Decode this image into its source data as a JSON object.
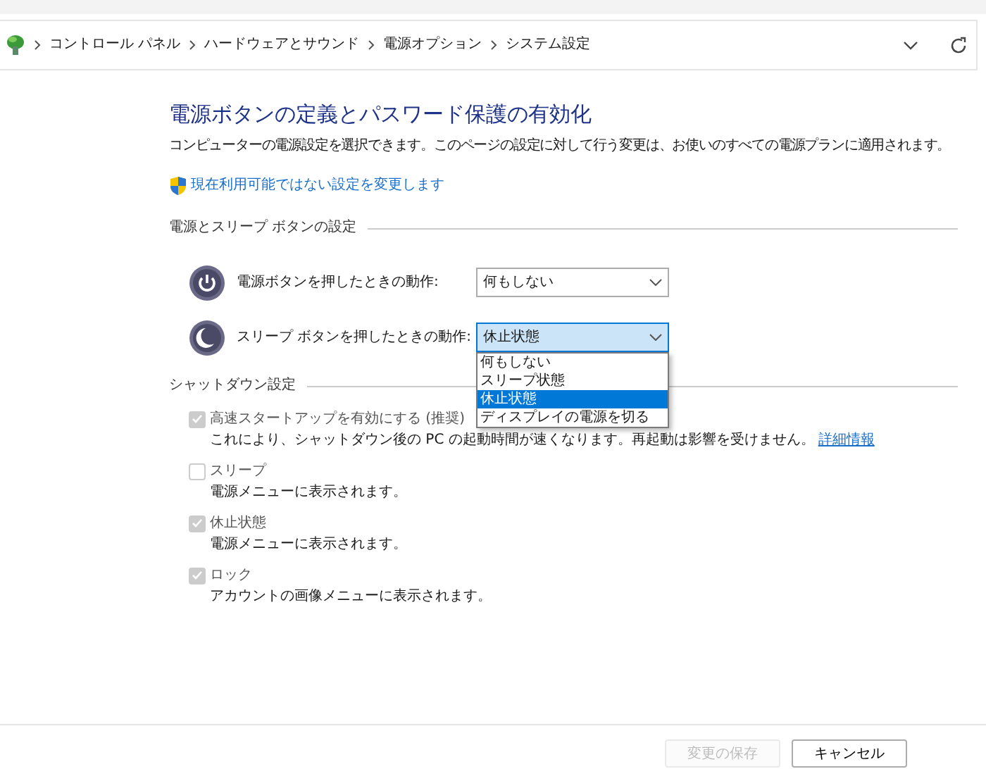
{
  "address_bar": {
    "breadcrumbs": [
      "コントロール パネル",
      "ハードウェアとサウンド",
      "電源オプション",
      "システム設定"
    ]
  },
  "page": {
    "title": "電源ボタンの定義とパスワード保護の有効化",
    "description": "コンピューターの電源設定を選択できます。このページの設定に対して行う変更は、お使いのすべての電源プランに適用されます。",
    "admin_link": "現在利用可能ではない設定を変更します"
  },
  "power_section": {
    "heading": "電源とスリープ ボタンの設定",
    "rows": [
      {
        "kind": "power",
        "label": "電源ボタンを押したときの動作:",
        "value": "何もしない",
        "expanded": false
      },
      {
        "kind": "sleep",
        "label": "スリープ ボタンを押したときの動作:",
        "value": "休止状態",
        "expanded": true,
        "options": [
          {
            "label": "何もしない",
            "selected": false
          },
          {
            "label": "スリープ状態",
            "selected": false
          },
          {
            "label": "休止状態",
            "selected": true
          },
          {
            "label": "ディスプレイの電源を切る",
            "selected": false
          }
        ]
      }
    ]
  },
  "shutdown_section": {
    "heading": "シャットダウン設定",
    "items": [
      {
        "label": "高速スタートアップを有効にする (推奨)",
        "checked": true,
        "disabled": true,
        "description": "これにより、シャットダウン後の PC の起動時間が速くなります。再起動は影響を受けません。",
        "link": "詳細情報"
      },
      {
        "label": "スリープ",
        "checked": false,
        "disabled": true,
        "description": "電源メニューに表示されます。"
      },
      {
        "label": "休止状態",
        "checked": true,
        "disabled": true,
        "description": "電源メニューに表示されます。"
      },
      {
        "label": "ロック",
        "checked": true,
        "disabled": true,
        "description": "アカウントの画像メニューに表示されます。"
      }
    ]
  },
  "buttons": [
    {
      "label": "変更の保存",
      "disabled": true
    },
    {
      "label": "キャンセル",
      "disabled": false
    }
  ]
}
